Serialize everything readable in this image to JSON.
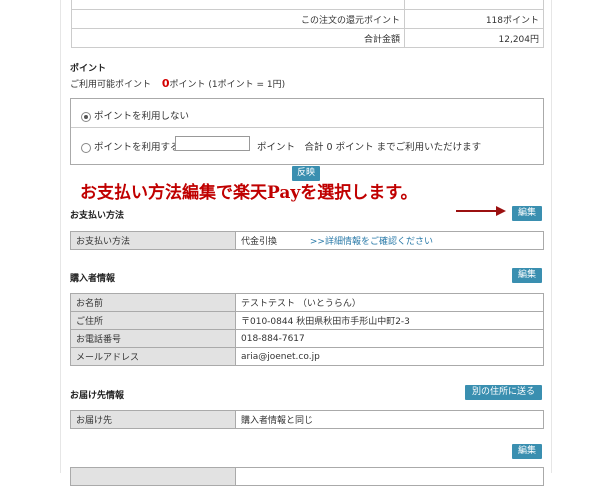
{
  "summary": {
    "rows": [
      {
        "label": "この注文の還元ポイント",
        "value": "118ポイント"
      },
      {
        "label": "合計金額",
        "value": "12,204円"
      }
    ]
  },
  "points": {
    "title": "ポイント",
    "available_prefix": "ご利用可能ポイント",
    "available_value": "0",
    "available_suffix": "ポイント (1ポイント = 1円)",
    "option_none": "ポイントを利用しない",
    "option_use": "ポイントを利用する",
    "use_suffix": "ポイント　合計 0 ポイント までご利用いただけます",
    "apply_button": "反映"
  },
  "annotation": {
    "text": "お支払い方法編集で楽天Payを選択します。",
    "arrow_color": "#9b1010"
  },
  "payment": {
    "title": "お支払い方法",
    "edit_button": "編集",
    "row_label": "お支払い方法",
    "row_value": "代金引換",
    "details_link": ">>詳細情報をご確認ください"
  },
  "purchaser": {
    "title": "購入者情報",
    "edit_button": "編集",
    "rows": [
      {
        "label": "お名前",
        "value": "テストテスト （いとうらん）"
      },
      {
        "label": "ご住所",
        "value": "〒010-0844  秋田県秋田市手形山中町2-3"
      },
      {
        "label": "お電話番号",
        "value": "018-884-7617"
      },
      {
        "label": "メールアドレス",
        "value": "aria@joenet.co.jp"
      }
    ]
  },
  "delivery": {
    "title": "お届け先情報",
    "other_address_button": "別の住所に送る",
    "row_label": "お届け先",
    "row_value": "購入者情報と同じ",
    "edit_button": "編集"
  },
  "colors": {
    "button_bg": "#3a8fb0",
    "annotation_red": "#c00000",
    "points_red": "#d40000"
  }
}
